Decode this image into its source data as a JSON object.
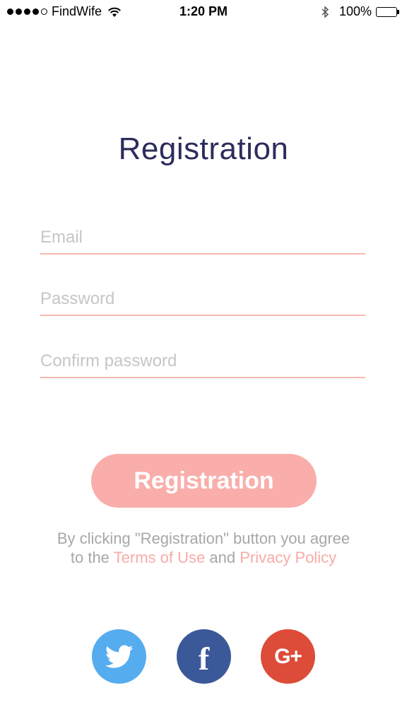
{
  "status_bar": {
    "carrier": "FindWife",
    "time": "1:20 PM",
    "battery": "100%"
  },
  "title": "Registration",
  "form": {
    "email_placeholder": "Email",
    "password_placeholder": "Password",
    "confirm_placeholder": "Confirm password"
  },
  "register_button": "Registration",
  "terms": {
    "line1": "By clicking \"Registration\" button you agree",
    "to_the": "to the",
    "terms_link": "Terms of Use",
    "and": "and",
    "privacy_link": "Privacy Policy"
  },
  "social": {
    "facebook_glyph": "f",
    "google_glyph": "G+"
  },
  "colors": {
    "accent": "#f9aeab",
    "title": "#2b2d5c",
    "twitter": "#55acee",
    "facebook": "#3b5998",
    "google": "#dd4b39"
  },
  "icons": {
    "signal": "signal-dots-icon",
    "wifi": "wifi-icon",
    "bluetooth": "bluetooth-icon",
    "battery": "battery-icon",
    "twitter": "twitter-bird-icon",
    "facebook": "facebook-icon",
    "google": "google-plus-icon"
  }
}
